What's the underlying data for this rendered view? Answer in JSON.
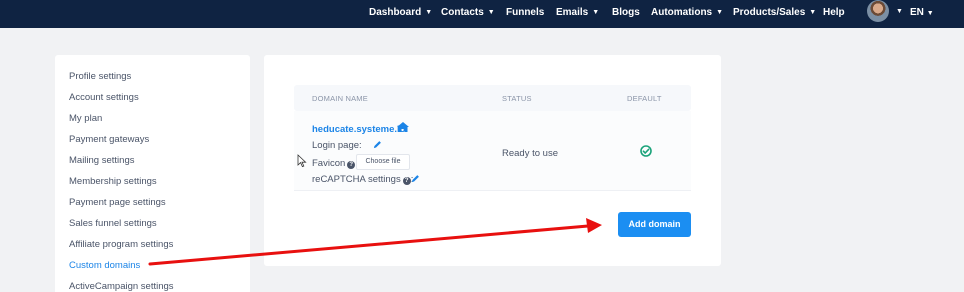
{
  "nav": {
    "items": [
      {
        "label": "Dashboard",
        "chevron": true
      },
      {
        "label": "Contacts",
        "chevron": true
      },
      {
        "label": "Funnels",
        "chevron": false
      },
      {
        "label": "Emails",
        "chevron": true
      },
      {
        "label": "Blogs",
        "chevron": false
      },
      {
        "label": "Automations",
        "chevron": true
      },
      {
        "label": "Products/Sales",
        "chevron": true
      },
      {
        "label": "Help",
        "chevron": false
      }
    ],
    "language": "EN",
    "bg_color": "#0f2342"
  },
  "sidebar": {
    "items": [
      {
        "label": "Profile settings"
      },
      {
        "label": "Account settings"
      },
      {
        "label": "My plan"
      },
      {
        "label": "Payment gateways"
      },
      {
        "label": "Mailing settings"
      },
      {
        "label": "Membership settings"
      },
      {
        "label": "Payment page settings"
      },
      {
        "label": "Sales funnel settings"
      },
      {
        "label": "Affiliate program settings"
      },
      {
        "label": "Custom domains",
        "active": true
      },
      {
        "label": "ActiveCampaign settings"
      }
    ]
  },
  "domains": {
    "headers": {
      "domain": "DOMAIN NAME",
      "status": "STATUS",
      "default": "DEFAULT"
    },
    "row": {
      "domain": "heducate.systeme.io",
      "login_label": "Login page:",
      "favicon_label": "Favicon",
      "favicon_suffix": ":",
      "choose_file": "Choose file",
      "recaptcha_label": "reCAPTCHA settings",
      "recaptcha_suffix": ":",
      "status": "Ready to use",
      "is_default": true
    },
    "add_button": "Add domain"
  },
  "colors": {
    "accent": "#1b84e7",
    "button": "#1b8ef2",
    "default_check": "#1aa37a",
    "annotation_arrow": "#e8100f"
  }
}
